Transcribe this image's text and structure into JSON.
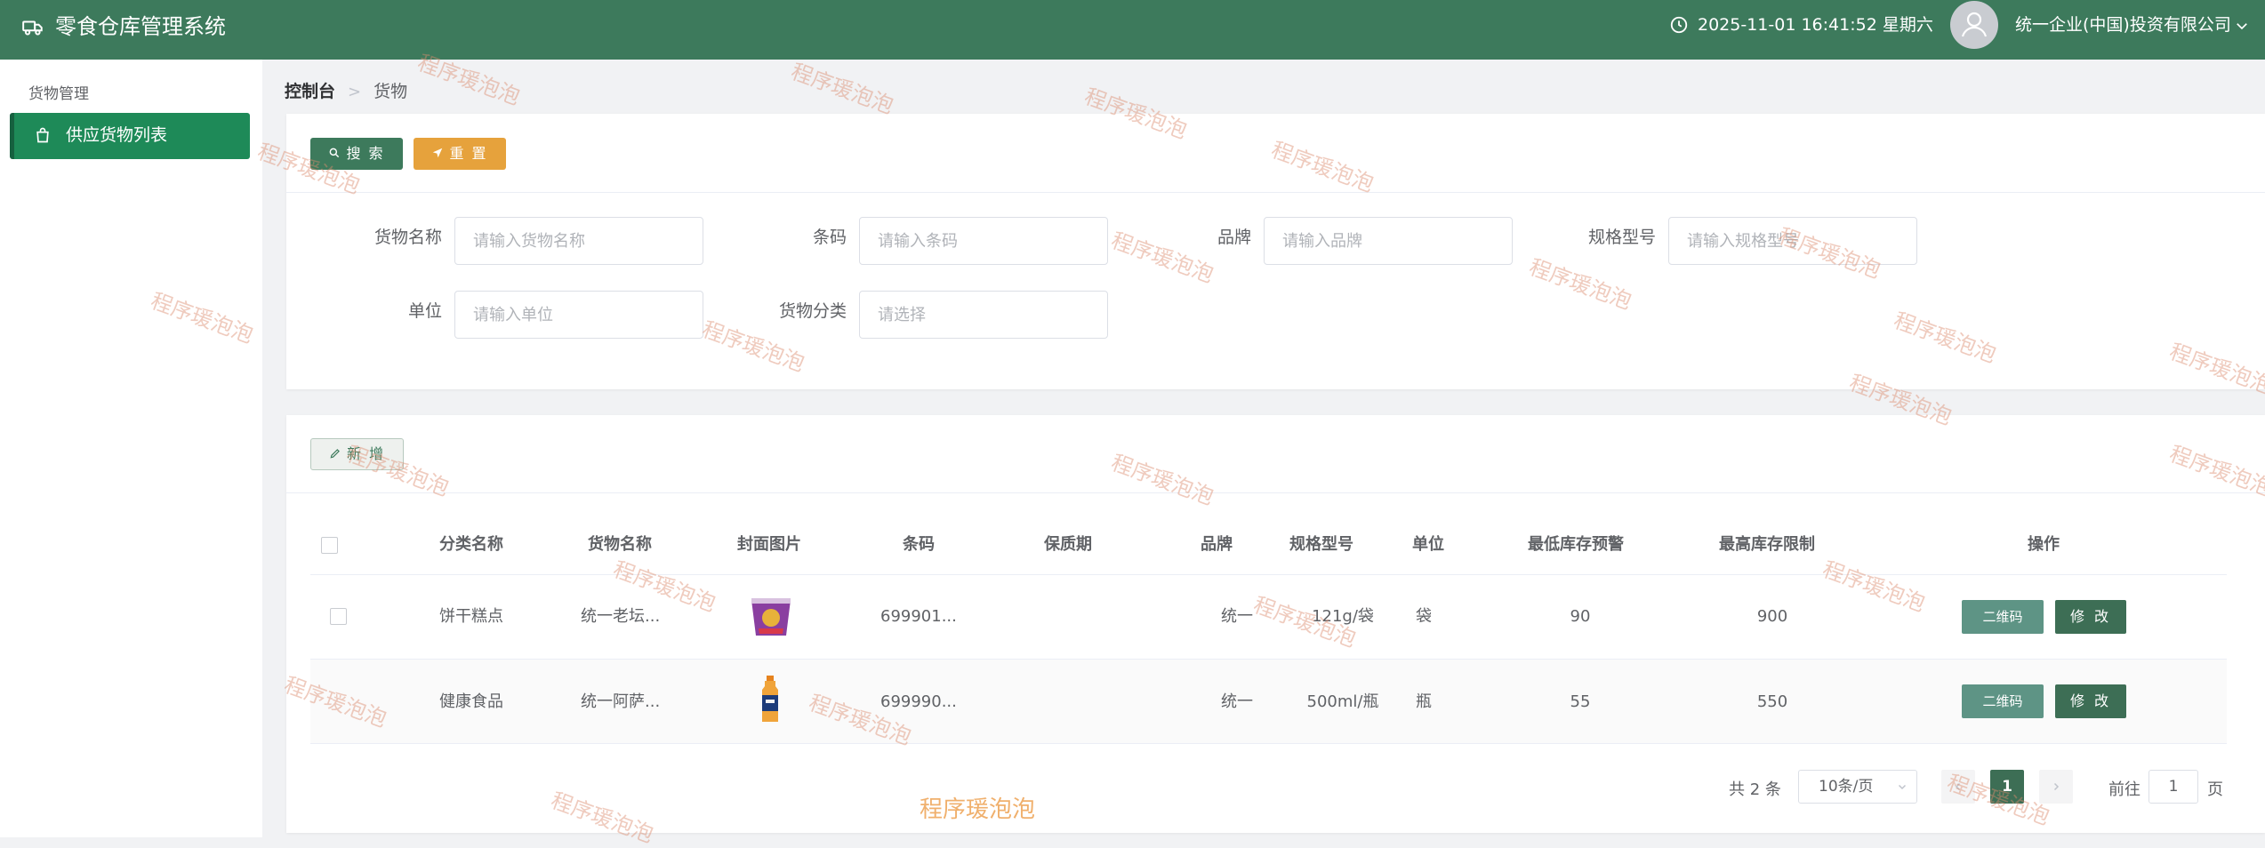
{
  "header": {
    "app_title": "零食仓库管理系统",
    "datetime": "2025-11-01 16:41:52 星期六",
    "company": "统一企业(中国)投资有限公司"
  },
  "sidebar": {
    "group_label": "货物管理",
    "items": [
      {
        "label": "供应货物列表",
        "active": true
      }
    ]
  },
  "breadcrumb": {
    "home": "控制台",
    "current": "货物"
  },
  "toolbar": {
    "search_label": "搜 索",
    "reset_label": "重 置",
    "add_label": "新 增"
  },
  "filters": {
    "name": {
      "label": "货物名称",
      "placeholder": "请输入货物名称"
    },
    "barcode": {
      "label": "条码",
      "placeholder": "请输入条码"
    },
    "brand": {
      "label": "品牌",
      "placeholder": "请输入品牌"
    },
    "spec": {
      "label": "规格型号",
      "placeholder": "请输入规格型号"
    },
    "unit": {
      "label": "单位",
      "placeholder": "请输入单位"
    },
    "category": {
      "label": "货物分类",
      "placeholder": "请选择"
    }
  },
  "table": {
    "columns": [
      "分类名称",
      "货物名称",
      "封面图片",
      "条码",
      "保质期",
      "品牌",
      "规格型号",
      "单位",
      "最低库存预警",
      "最高库存限制",
      "操作"
    ],
    "rows": [
      {
        "category": "饼干糕点",
        "name": "统一老坛...",
        "image": "cup-noodle-image",
        "barcode": "699901...",
        "shelf_life": "",
        "brand": "统一",
        "spec": "121g/袋",
        "unit": "袋",
        "min_stock": "90",
        "max_stock": "900",
        "qr_label": "二维码",
        "edit_label": "修 改"
      },
      {
        "category": "健康食品",
        "name": "统一阿萨...",
        "image": "bottle-drink-image",
        "barcode": "699990...",
        "shelf_life": "",
        "brand": "统一",
        "spec": "500ml/瓶",
        "unit": "瓶",
        "min_stock": "55",
        "max_stock": "550",
        "qr_label": "二维码",
        "edit_label": "修 改"
      }
    ]
  },
  "pagination": {
    "total_text": "共 2 条",
    "page_size": "10条/页",
    "current_page": "1",
    "goto_label": "前往",
    "goto_value": "1",
    "page_suffix": "页"
  },
  "watermark": "程序瑗泡泡",
  "colors": {
    "header_bg": "#3d7a5c",
    "active_menu": "#1e8a58",
    "reset_btn": "#e6a23c"
  }
}
